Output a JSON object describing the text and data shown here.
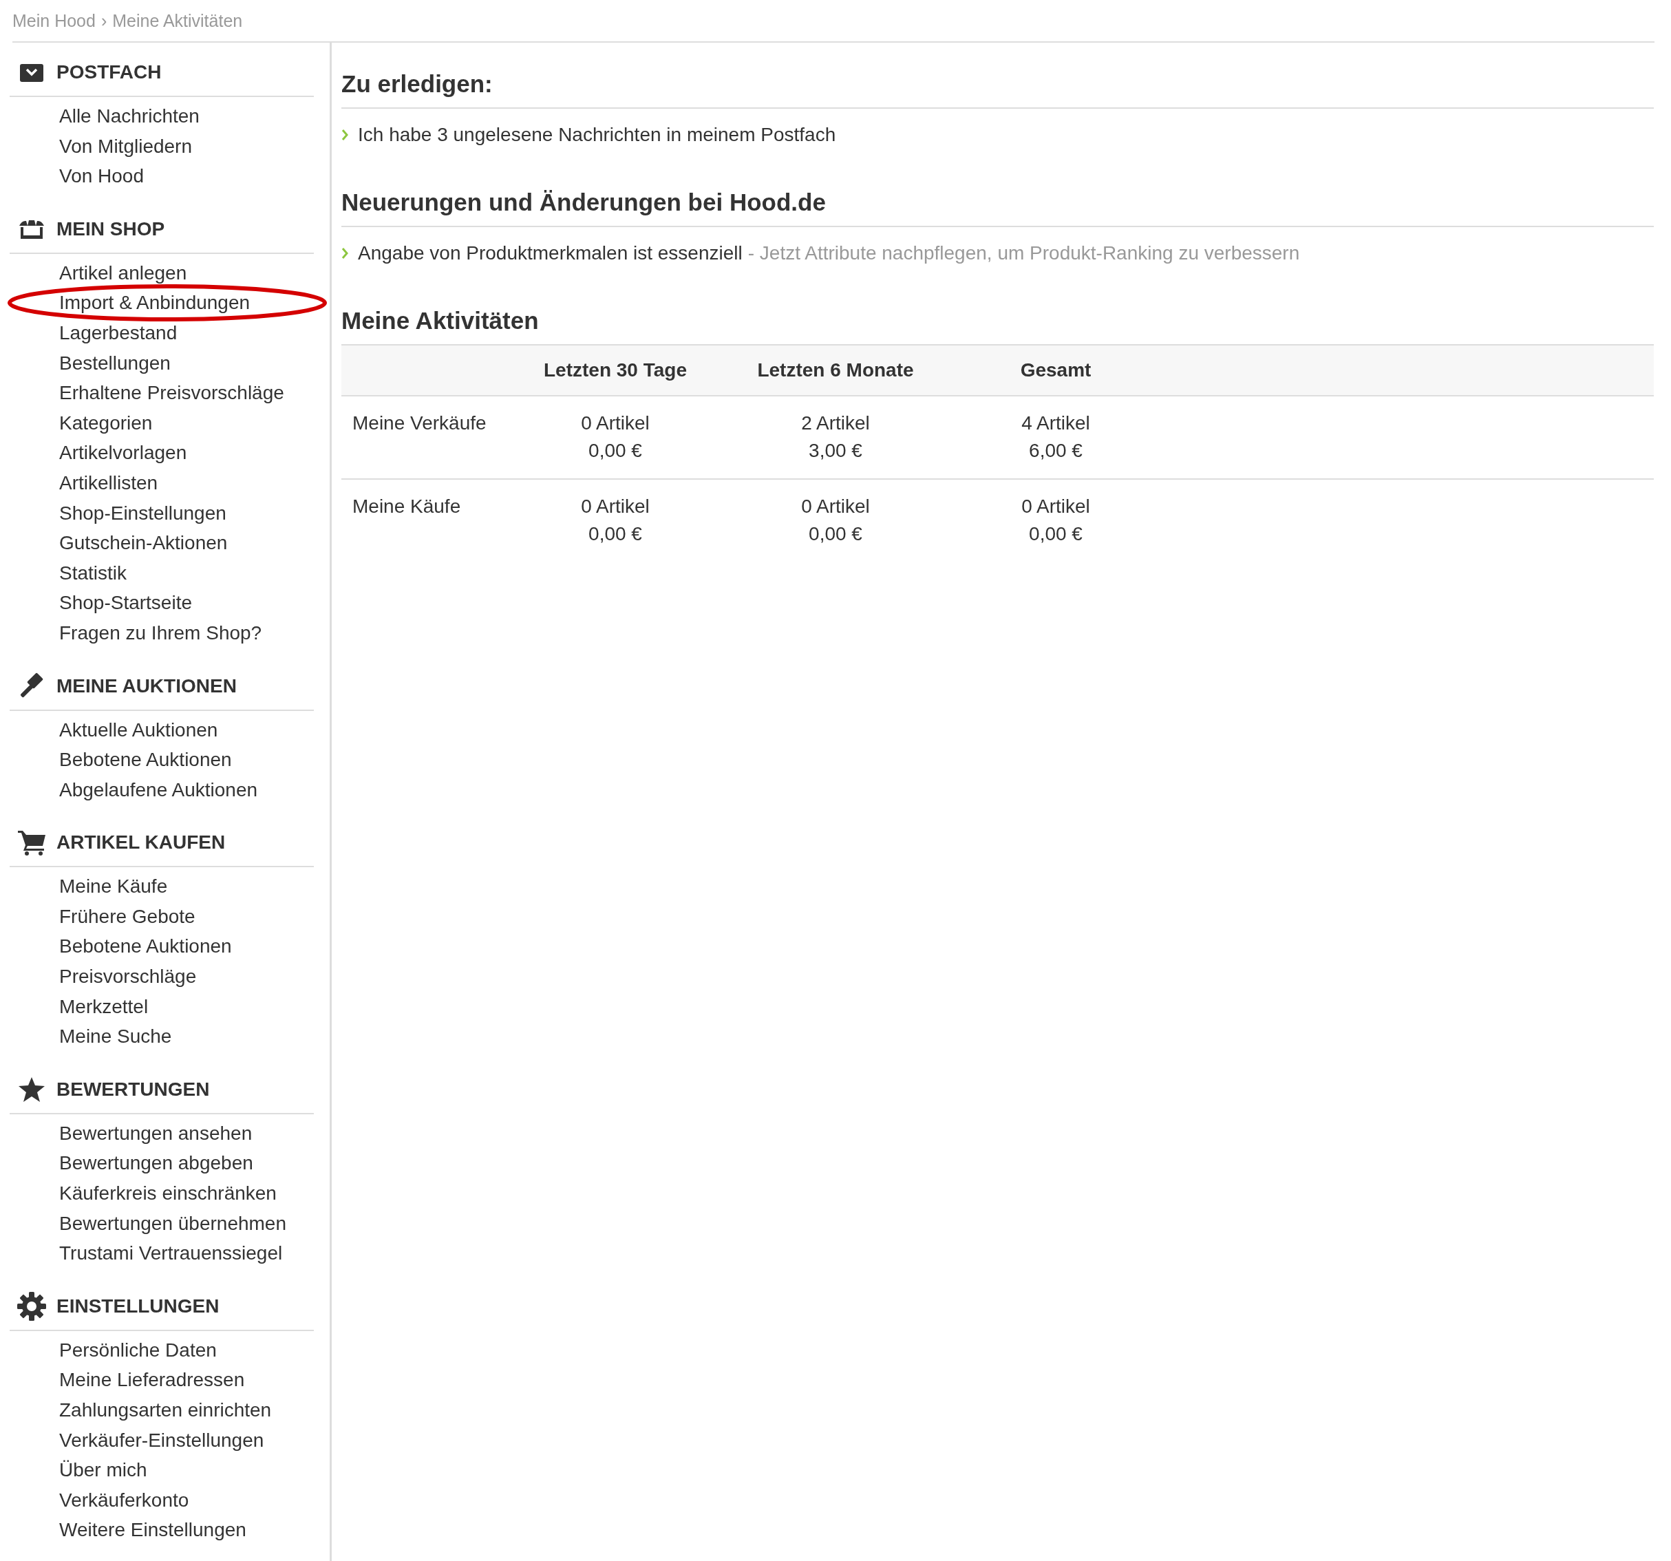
{
  "breadcrumb": {
    "items": [
      "Mein Hood",
      "Meine Aktivitäten"
    ],
    "separator": "›"
  },
  "sidebar": {
    "sections": [
      {
        "title": "POSTFACH",
        "kind": "mail",
        "items": [
          {
            "label": "Alle Nachrichten",
            "circled": false
          },
          {
            "label": "Von Mitgliedern",
            "circled": false
          },
          {
            "label": "Von Hood",
            "circled": false
          }
        ]
      },
      {
        "title": "MEIN SHOP",
        "kind": "shop",
        "items": [
          {
            "label": "Artikel anlegen",
            "circled": false
          },
          {
            "label": "Import & Anbindungen",
            "circled": true
          },
          {
            "label": "Lagerbestand",
            "circled": false
          },
          {
            "label": "Bestellungen",
            "circled": false
          },
          {
            "label": "Erhaltene Preisvorschläge",
            "circled": false
          },
          {
            "label": "Kategorien",
            "circled": false
          },
          {
            "label": "Artikelvorlagen",
            "circled": false
          },
          {
            "label": "Artikellisten",
            "circled": false
          },
          {
            "label": "Shop-Einstellungen",
            "circled": false
          },
          {
            "label": "Gutschein-Aktionen",
            "circled": false
          },
          {
            "label": "Statistik",
            "circled": false
          },
          {
            "label": "Shop-Startseite",
            "circled": false
          },
          {
            "label": "Fragen zu Ihrem Shop?",
            "circled": false
          }
        ]
      },
      {
        "title": "MEINE AUKTIONEN",
        "kind": "auction",
        "items": [
          {
            "label": "Aktuelle Auktionen",
            "circled": false
          },
          {
            "label": "Bebotene Auktionen",
            "circled": false
          },
          {
            "label": "Abgelaufene Auktionen",
            "circled": false
          }
        ]
      },
      {
        "title": "ARTIKEL KAUFEN",
        "kind": "cart",
        "items": [
          {
            "label": "Meine Käufe",
            "circled": false
          },
          {
            "label": "Frühere Gebote",
            "circled": false
          },
          {
            "label": "Bebotene Auktionen",
            "circled": false
          },
          {
            "label": "Preisvorschläge",
            "circled": false
          },
          {
            "label": "Merkzettel",
            "circled": false
          },
          {
            "label": "Meine Suche",
            "circled": false
          }
        ]
      },
      {
        "title": "BEWERTUNGEN",
        "kind": "rating",
        "items": [
          {
            "label": "Bewertungen ansehen",
            "circled": false
          },
          {
            "label": "Bewertungen abgeben",
            "circled": false
          },
          {
            "label": "Käuferkreis einschränken",
            "circled": false
          },
          {
            "label": "Bewertungen übernehmen",
            "circled": false
          },
          {
            "label": "Trustami Vertrauenssiegel",
            "circled": false
          }
        ]
      },
      {
        "title": "EINSTELLUNGEN",
        "kind": "settings",
        "items": [
          {
            "label": "Persönliche Daten",
            "circled": false
          },
          {
            "label": "Meine Lieferadressen",
            "circled": false
          },
          {
            "label": "Zahlungsarten einrichten",
            "circled": false
          },
          {
            "label": "Verkäufer-Einstellungen",
            "circled": false
          },
          {
            "label": "Über mich",
            "circled": false
          },
          {
            "label": "Verkäuferkonto",
            "circled": false
          },
          {
            "label": "Weitere Einstellungen",
            "circled": false
          }
        ]
      }
    ]
  },
  "todo": {
    "title": "Zu erledigen:",
    "items": [
      {
        "text": "Ich habe 3 ungelesene Nachrichten in meinem Postfach"
      }
    ]
  },
  "news": {
    "title": "Neuerungen und Änderungen bei Hood.de",
    "items": [
      {
        "text": "Angabe von Produktmerkmalen ist essenziell",
        "note": "- Jetzt Attribute nachpflegen, um Produkt-Ranking zu verbessern"
      }
    ]
  },
  "activities": {
    "title": "Meine Aktivitäten",
    "columns": [
      "Letzten 30 Tage",
      "Letzten 6 Monate",
      "Gesamt"
    ],
    "rows": [
      {
        "label": "Meine Verkäufe",
        "cells": [
          {
            "count": "0 Artikel",
            "amount": "0,00 €"
          },
          {
            "count": "2 Artikel",
            "amount": "3,00 €"
          },
          {
            "count": "4 Artikel",
            "amount": "6,00 €"
          }
        ]
      },
      {
        "label": "Meine Käufe",
        "cells": [
          {
            "count": "0 Artikel",
            "amount": "0,00 €"
          },
          {
            "count": "0 Artikel",
            "amount": "0,00 €"
          },
          {
            "count": "0 Artikel",
            "amount": "0,00 €"
          }
        ]
      }
    ]
  }
}
